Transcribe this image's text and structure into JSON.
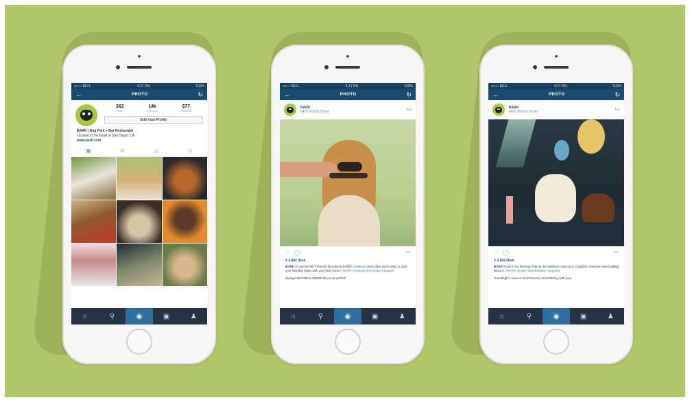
{
  "colors": {
    "background": "#b1c66a",
    "nav": "#1b4c70",
    "tabbar": "#253342",
    "accent": "#2e6fa0"
  },
  "phones": [
    {
      "status": {
        "carrier": "•••○○ BELL",
        "time": "4:21 PM",
        "battery": "100%"
      },
      "nav": {
        "title": "PHOTO",
        "back_icon": "back-arrow-icon",
        "refresh_icon": "refresh-icon"
      },
      "profile": {
        "posts_count": "363",
        "posts_label": "posts",
        "followers_count": "14k",
        "followers_label": "followers",
        "following_count": "677",
        "following_label": "following",
        "edit_button": "Edit Your Profile",
        "name": "BARK | Dog Park + Bar Restaurant",
        "tagline": "Located in the heart of San Diego, CA",
        "website": "www.bark.com"
      },
      "view_tabs": [
        "grid-icon",
        "list-icon",
        "location-icon",
        "tagged-icon"
      ],
      "tabbar": [
        "home-icon",
        "search-icon",
        "camera-icon",
        "activity-icon",
        "profile-icon"
      ]
    },
    {
      "status": {
        "carrier": "•••○○ BELL",
        "time": "4:21 PM",
        "battery": "100%"
      },
      "nav": {
        "title": "PHOTO",
        "back_icon": "back-arrow-icon",
        "refresh_icon": "refresh-icon"
      },
      "post": {
        "username": "BARK",
        "location": "8470 Burnet Street",
        "likes": "♥ 3,942 likes",
        "caption_user": "BARK",
        "caption": "It must be MUTTstache Monday at BARK! Come on down after work today to cure your Monday blues with your best friend.",
        "caption_tags": "#BARK #muttstachemonday #dogpark",
        "comment": "wineyposted #BAAARRRK this is so perfect!"
      },
      "tabbar": [
        "home-icon",
        "search-icon",
        "camera-icon",
        "activity-icon",
        "profile-icon"
      ]
    },
    {
      "status": {
        "carrier": "•••○○ BELL",
        "time": "4:21 PM",
        "battery": "100%"
      },
      "nav": {
        "title": "PHOTO",
        "back_icon": "back-arrow-icon",
        "refresh_icon": "refresh-icon"
      },
      "post": {
        "username": "BARK",
        "location": "8470 Burnet Street",
        "likes": "♥ 3,942 likes",
        "caption_user": "BARK",
        "caption": "Rosie's 3rd Birthday Paw-ty this weekend was such a pawsty, everyone was barking about it.",
        "caption_tags": "#BARK #pawty #barkbirthday #dogpark",
        "comment": "Guesthigh! I have to book Rosie's next birthday with you!"
      },
      "tabbar": [
        "home-icon",
        "search-icon",
        "camera-icon",
        "activity-icon",
        "profile-icon"
      ]
    }
  ]
}
